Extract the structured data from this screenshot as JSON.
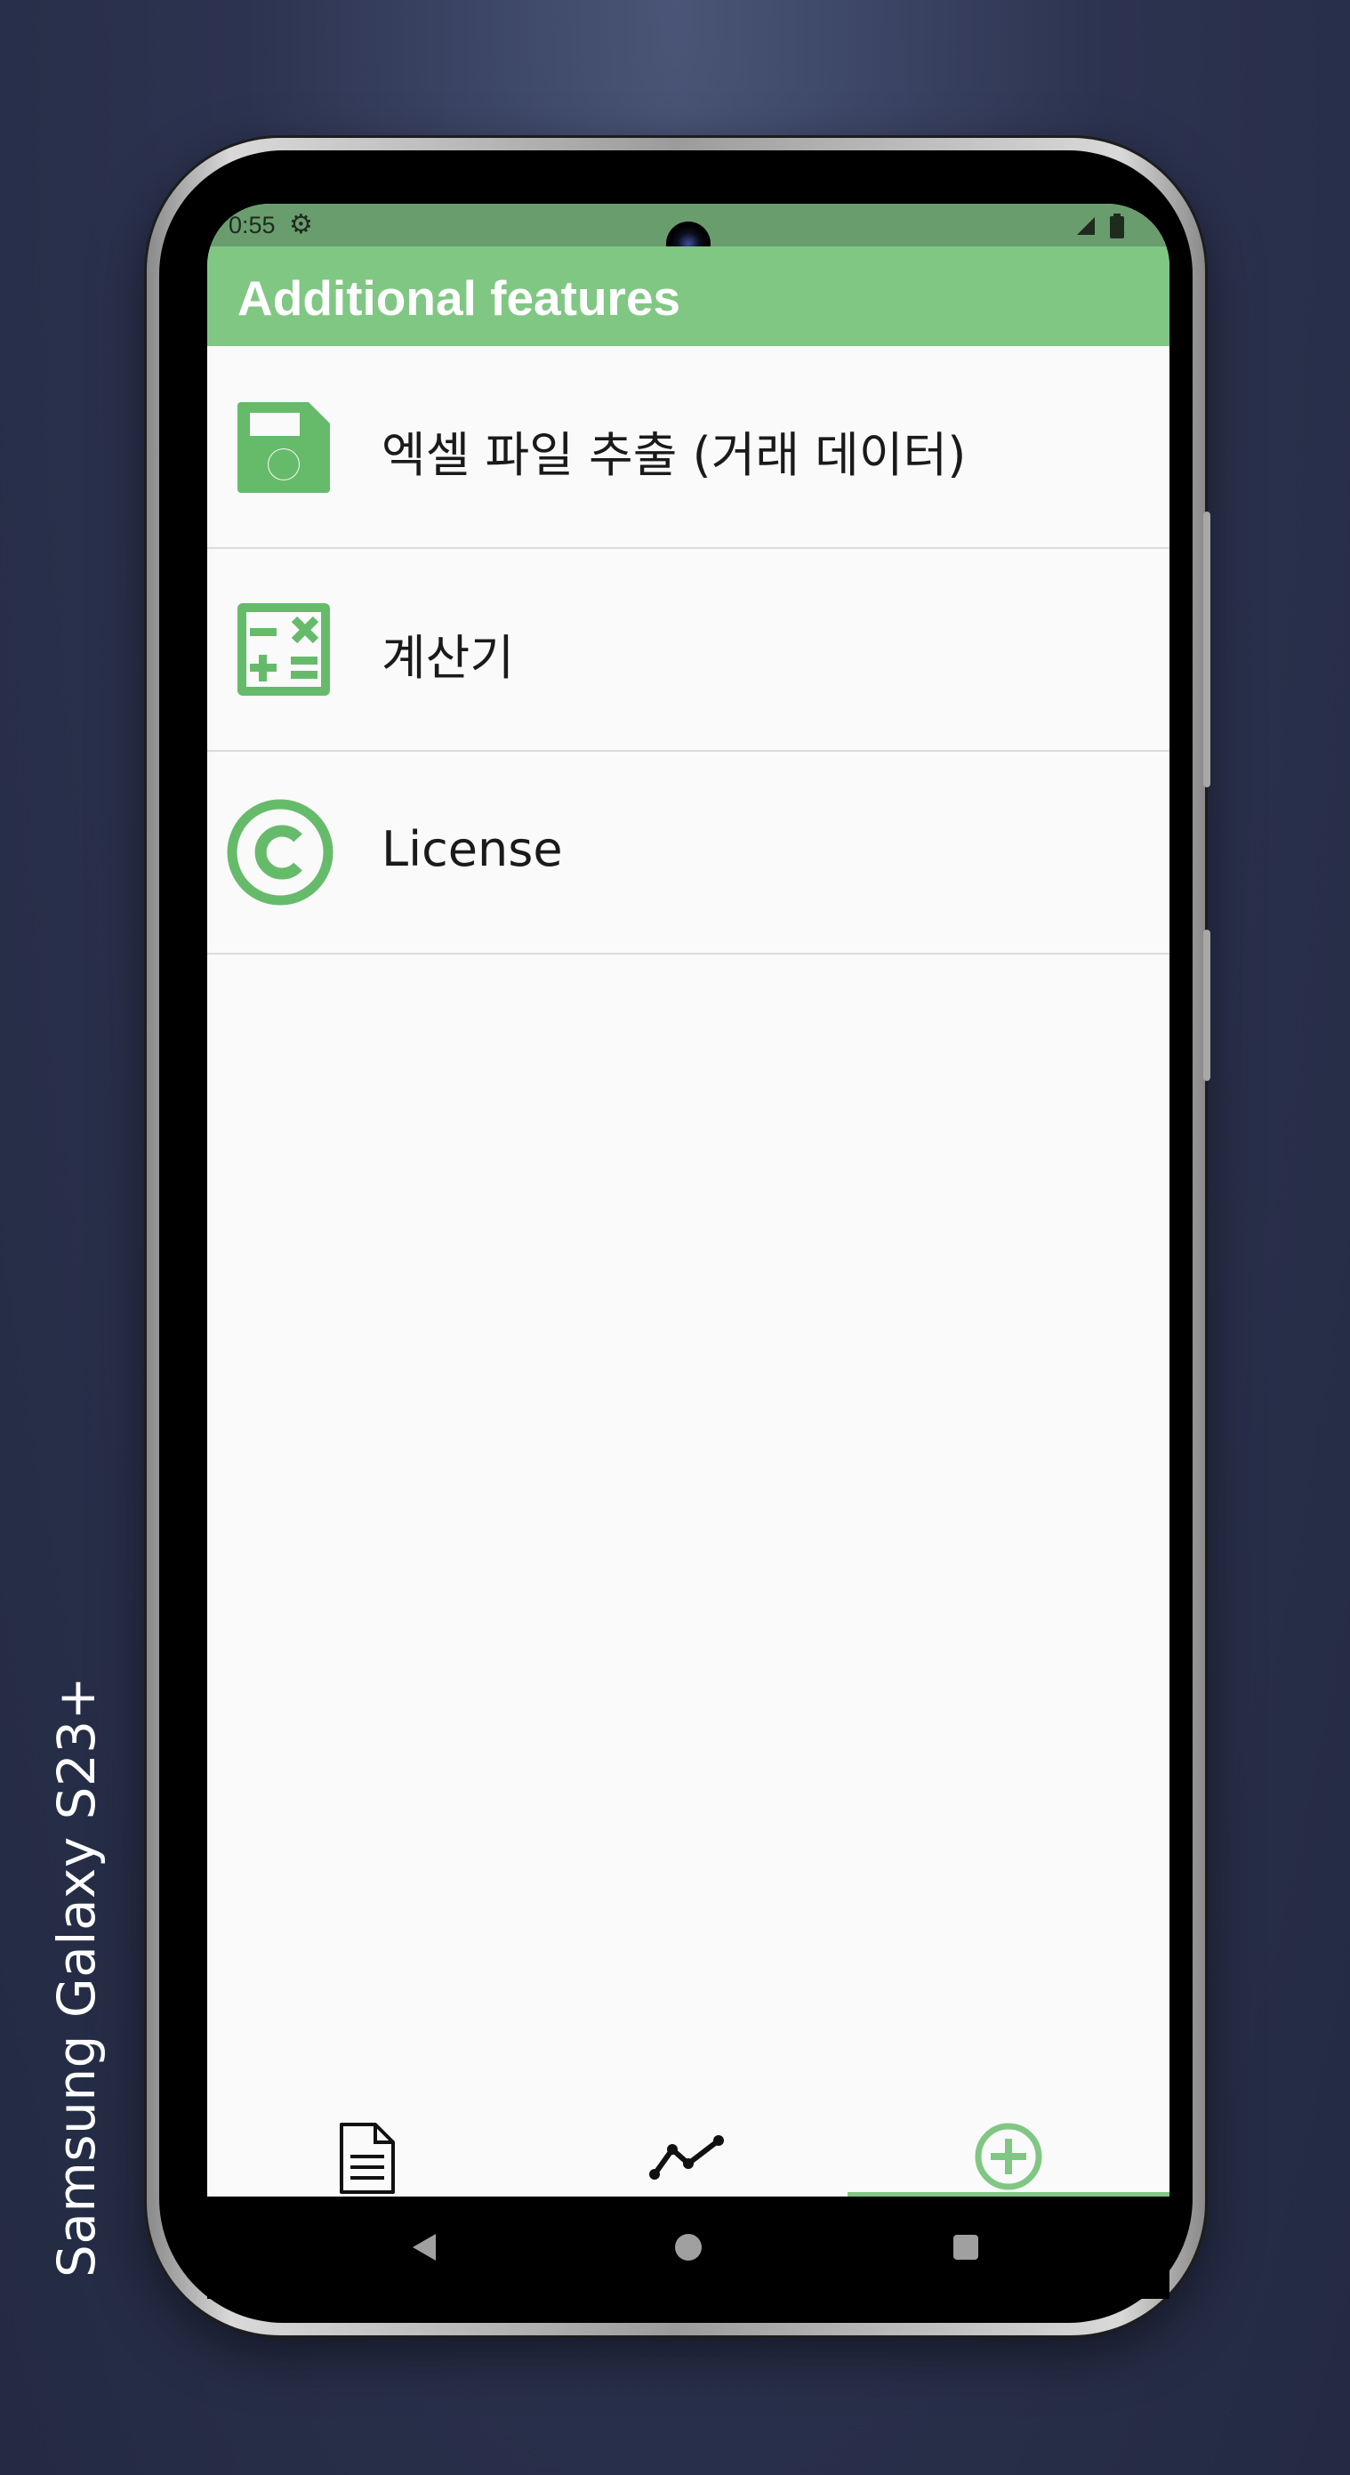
{
  "device": {
    "brand_label": "Samsung Galaxy  S23+"
  },
  "status_bar": {
    "time": "0:55"
  },
  "app_bar": {
    "title": "Additional features"
  },
  "list": [
    {
      "label": "엑셀 파일 추출 (거래 데이터)",
      "icon": "save-icon"
    },
    {
      "label": "계산기",
      "icon": "calculator-icon"
    },
    {
      "label": "License",
      "icon": "copyright-icon"
    }
  ],
  "bottom_nav": {
    "tabs": [
      {
        "icon": "document-icon",
        "selected": false
      },
      {
        "icon": "chart-line-icon",
        "selected": false
      },
      {
        "icon": "add-circle-icon",
        "selected": true
      }
    ]
  },
  "colors": {
    "accent": "#81c784",
    "status_bar": "#6a9d6e",
    "icon_green": "#66bb6a"
  }
}
